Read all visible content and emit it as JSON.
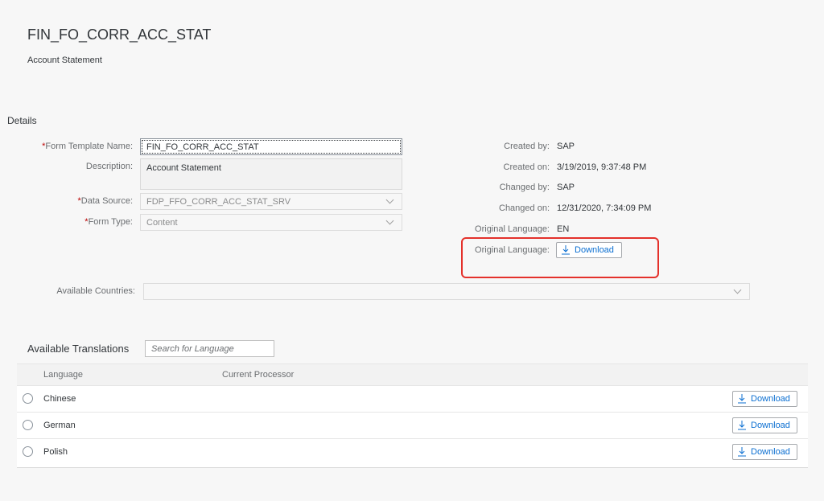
{
  "header": {
    "title": "FIN_FO_CORR_ACC_STAT",
    "subtitle": "Account Statement"
  },
  "details": {
    "section_title": "Details",
    "form_template_name_label": "Form Template Name:",
    "form_template_name_value": "FIN_FO_CORR_ACC_STAT",
    "description_label": "Description:",
    "description_value": "Account Statement",
    "data_source_label": "Data Source:",
    "data_source_value": "FDP_FFO_CORR_ACC_STAT_SRV",
    "form_type_label": "Form Type:",
    "form_type_value": "Content",
    "available_countries_label": "Available Countries:",
    "available_countries_value": "",
    "required_marker": "*"
  },
  "meta": {
    "created_by_label": "Created by:",
    "created_by_value": "SAP",
    "created_on_label": "Created on:",
    "created_on_value": "3/19/2019, 9:37:48 PM",
    "changed_by_label": "Changed by:",
    "changed_by_value": "SAP",
    "changed_on_label": "Changed on:",
    "changed_on_value": "12/31/2020, 7:34:09 PM",
    "original_language_label": "Original Language:",
    "original_language_value": "EN",
    "original_language_download_label": "Original Language:",
    "download_label": "Download"
  },
  "translations": {
    "title": "Available Translations",
    "search_placeholder": "Search for Language",
    "columns": [
      "Language",
      "Current Processor"
    ],
    "rows": [
      {
        "language": "Chinese",
        "processor": "",
        "download": "Download"
      },
      {
        "language": "German",
        "processor": "",
        "download": "Download"
      },
      {
        "language": "Polish",
        "processor": "",
        "download": "Download"
      }
    ]
  },
  "colors": {
    "accent": "#0a6ed1",
    "required": "#bb0000",
    "highlight": "#e4312b"
  },
  "icons": {
    "download": "download-icon",
    "chevron": "chevron-down-icon",
    "radio": "radio-button"
  }
}
